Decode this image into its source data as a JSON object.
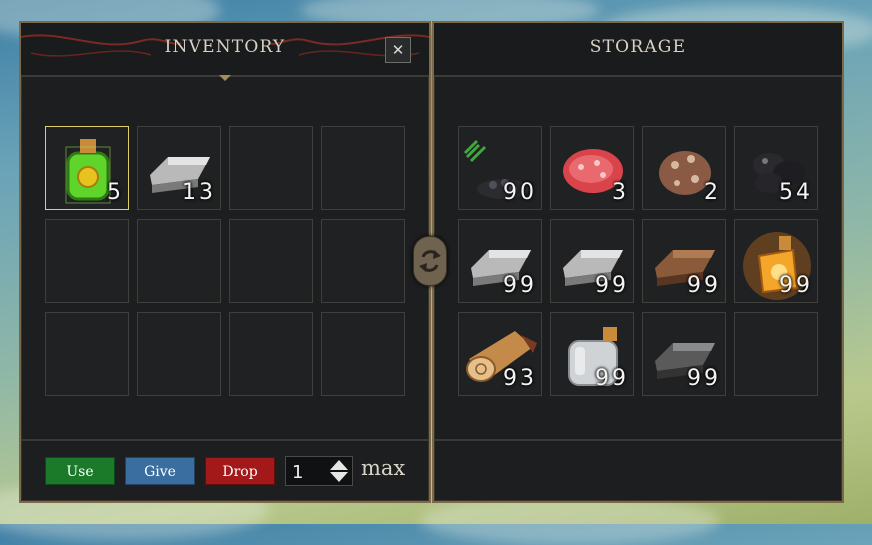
{
  "inventory": {
    "title": "INVENTORY",
    "close_label": "✕",
    "slots": [
      {
        "icon": "green-potion-icon",
        "qty": "5",
        "selected": true
      },
      {
        "icon": "iron-ingot-icon",
        "qty": "13"
      },
      {
        "icon": "",
        "qty": ""
      },
      {
        "icon": "",
        "qty": ""
      },
      {
        "icon": "",
        "qty": ""
      },
      {
        "icon": "",
        "qty": ""
      },
      {
        "icon": "",
        "qty": ""
      },
      {
        "icon": "",
        "qty": ""
      },
      {
        "icon": "",
        "qty": ""
      },
      {
        "icon": "",
        "qty": ""
      },
      {
        "icon": "",
        "qty": ""
      },
      {
        "icon": "",
        "qty": ""
      }
    ],
    "buttons": {
      "use": "Use",
      "give": "Give",
      "drop": "Drop"
    },
    "quantity_value": "1",
    "max_label": "max"
  },
  "storage": {
    "title": "STORAGE",
    "slots": [
      {
        "icon": "herb-seeds-icon",
        "qty": "90"
      },
      {
        "icon": "raw-meat-icon",
        "qty": "3"
      },
      {
        "icon": "ore-chunk-icon",
        "qty": "2"
      },
      {
        "icon": "coal-icon",
        "qty": "54"
      },
      {
        "icon": "iron-ingot-icon",
        "qty": "99"
      },
      {
        "icon": "iron-ingot-icon",
        "qty": "99"
      },
      {
        "icon": "copper-ingot-icon",
        "qty": "99"
      },
      {
        "icon": "fire-potion-icon",
        "qty": "99"
      },
      {
        "icon": "wood-log-icon",
        "qty": "93"
      },
      {
        "icon": "empty-bottle-icon",
        "qty": "99"
      },
      {
        "icon": "dark-ingot-icon",
        "qty": "99"
      },
      {
        "icon": "",
        "qty": ""
      }
    ]
  },
  "colors": {
    "use": "#1a7a2a",
    "give": "#3a6ea0",
    "drop": "#a31818",
    "selected_border": "#e1cf61"
  }
}
